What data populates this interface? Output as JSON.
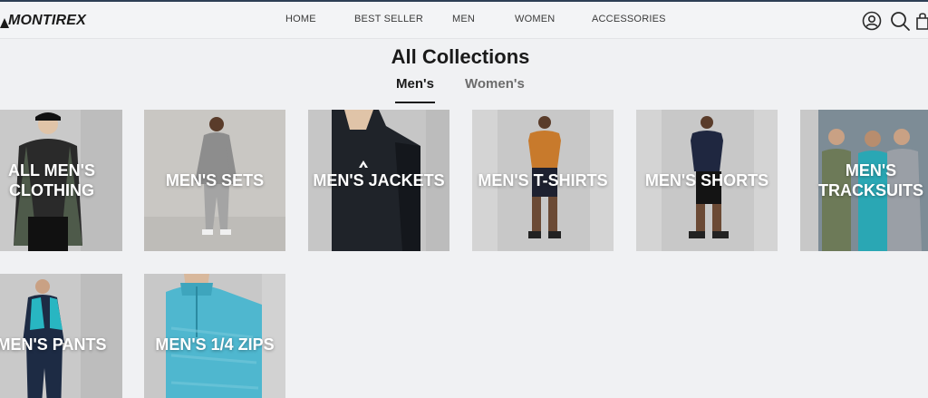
{
  "brand": {
    "name": "MONTIREX"
  },
  "nav": {
    "items": [
      {
        "label": "HOME"
      },
      {
        "label": "BEST SELLER"
      },
      {
        "label": "MEN"
      },
      {
        "label": "WOMEN"
      },
      {
        "label": "ACCESSORIES"
      }
    ]
  },
  "header_icons": [
    "account-icon",
    "search-icon",
    "cart-icon"
  ],
  "page": {
    "title": "All Collections",
    "tabs": [
      {
        "label": "Men's",
        "active": true
      },
      {
        "label": "Women's",
        "active": false
      }
    ]
  },
  "collections": [
    {
      "label": "ALL MEN'S CLOTHING"
    },
    {
      "label": "MEN'S SETS"
    },
    {
      "label": "MEN'S JACKETS"
    },
    {
      "label": "MEN'S T-SHIRTS"
    },
    {
      "label": "MEN'S SHORTS"
    },
    {
      "label": "MEN'S TRACKSUITS"
    },
    {
      "label": "MEN'S PANTS"
    },
    {
      "label": "MEN'S 1/4 ZIPS"
    }
  ],
  "colors": {
    "background": "#f0f1f3",
    "header_border": "#2d3f55",
    "text": "#1a1a1a",
    "card_bg": "#c8c8c8"
  }
}
